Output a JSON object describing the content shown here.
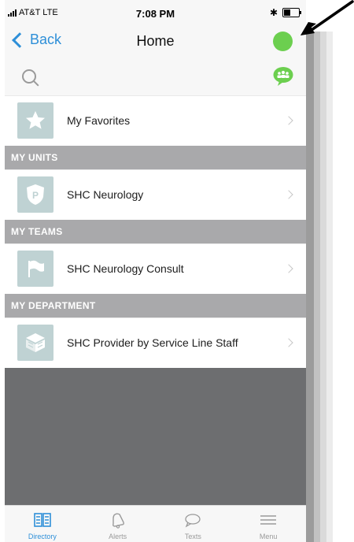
{
  "status_bar": {
    "carrier": "AT&T",
    "network": "LTE",
    "time": "7:08 PM",
    "bluetooth": "✱"
  },
  "nav": {
    "back_label": "Back",
    "title": "Home"
  },
  "colors": {
    "accent": "#2e8fd8",
    "presence": "#6ccf4f",
    "group_chat": "#6ccf4f",
    "section_bg": "#a9a9ab",
    "icon_tile": "#bfd2d3"
  },
  "favorites": {
    "label": "My Favorites",
    "icon": "star-icon"
  },
  "sections": [
    {
      "header": "MY UNITS",
      "item": {
        "label": "SHC Neurology",
        "icon": "badge-p-icon"
      }
    },
    {
      "header": "MY TEAMS",
      "item": {
        "label": "SHC Neurology Consult",
        "icon": "flag-icon"
      }
    },
    {
      "header": "MY DEPARTMENT",
      "item": {
        "label": "SHC Provider by Service Line Staff",
        "icon": "building-icon"
      }
    }
  ],
  "unit_badge_letter": "P",
  "tabs": [
    {
      "label": "Directory",
      "icon": "directory-icon",
      "active": true
    },
    {
      "label": "Alerts",
      "icon": "bell-icon",
      "active": false
    },
    {
      "label": "Texts",
      "icon": "speech-bubble-icon",
      "active": false
    },
    {
      "label": "Menu",
      "icon": "hamburger-icon",
      "active": false
    }
  ]
}
